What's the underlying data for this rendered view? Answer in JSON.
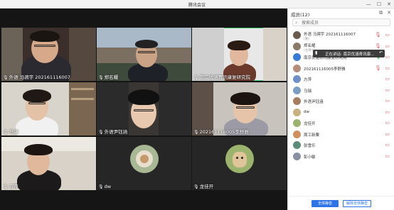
{
  "window": {
    "title": "腾讯会议"
  },
  "video": {
    "tiles": [
      {
        "label": "外语 马骋宇 202161116007"
      },
      {
        "label": "郑名耀"
      },
      {
        "label": "南京优涵青讯康复研究院"
      },
      {
        "label": "马瑞"
      },
      {
        "label": "外语尹钰涵"
      },
      {
        "label": "202161116005李舒雅"
      },
      {
        "label": "方萍"
      },
      {
        "label": "dw"
      },
      {
        "label": "龙佳开"
      }
    ]
  },
  "panel": {
    "header": "成员(12)",
    "search_placeholder": "搜索成员",
    "members": [
      {
        "name": "外语 马骋宇 202161116007",
        "sub": "(我)"
      },
      {
        "name": "郑名耀",
        "sub": "(主持人)"
      },
      {
        "name": "南京优涵青讯康复研究院",
        "sub": ""
      },
      {
        "name": "202161116005李舒雅",
        "sub": ""
      },
      {
        "name": "方萍",
        "sub": ""
      },
      {
        "name": "马瑞",
        "sub": ""
      },
      {
        "name": "外语尹钰涵",
        "sub": ""
      },
      {
        "name": "dw",
        "sub": ""
      },
      {
        "name": "龙佳开",
        "sub": ""
      },
      {
        "name": "周工新粟",
        "sub": ""
      },
      {
        "name": "张雪乐",
        "sub": ""
      },
      {
        "name": "彭小敏",
        "sub": ""
      }
    ],
    "tooltip": "正在讲话: 南京优涵青讯康...",
    "footer": {
      "mute_all": "全体静音",
      "unmute_all": "解除全体静音"
    }
  },
  "colors": {
    "accent": "#2f74e6",
    "speaking": "#3ec46d",
    "muted": "#e0626a"
  }
}
